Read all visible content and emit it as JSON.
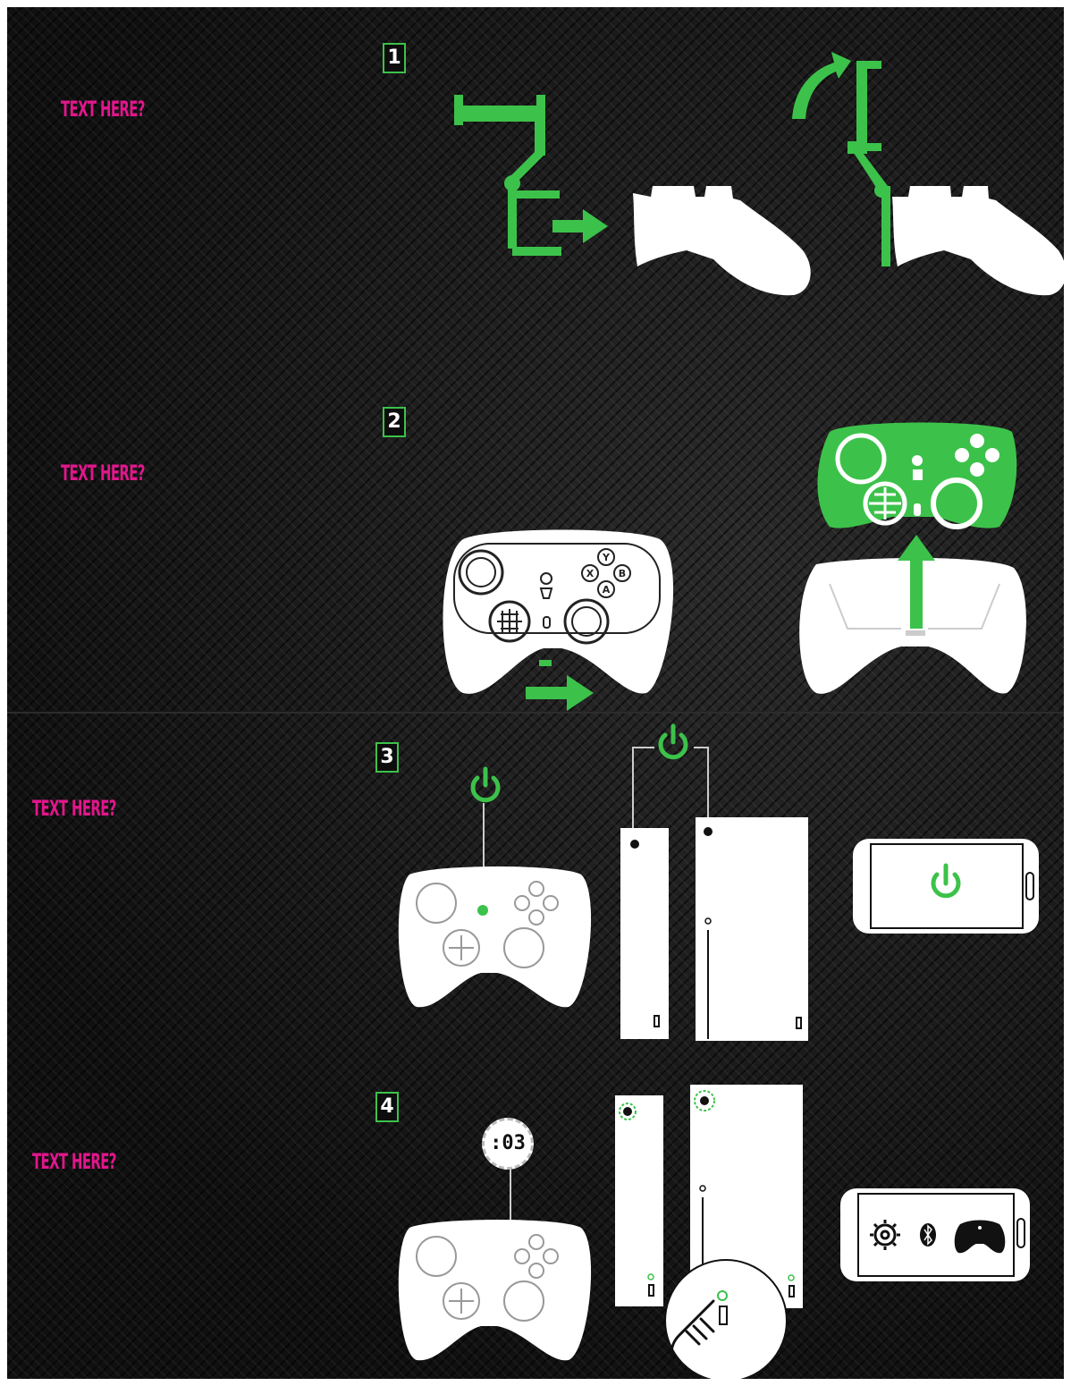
{
  "steps": [
    {
      "number": "1",
      "label": "TEXT HERE?"
    },
    {
      "number": "2",
      "label": "TEXT HERE?"
    },
    {
      "number": "3",
      "label": "TEXT HERE?"
    },
    {
      "number": "4",
      "label": "TEXT HERE?"
    }
  ],
  "timer": {
    "value": ":03"
  },
  "controller": {
    "face_buttons": [
      "Y",
      "X",
      "B",
      "A"
    ]
  },
  "colors": {
    "accent_green": "#3cc24a",
    "label_pink": "#e2168c",
    "background": "#141414",
    "line_art": "#ffffff"
  },
  "icons": [
    "power-icon",
    "gear-icon",
    "bluetooth-icon",
    "gamepad-icon",
    "hand-pointer-icon",
    "xbox-logo-icon",
    "arrow-right-icon",
    "arrow-up-icon",
    "rotate-arrow-icon"
  ]
}
